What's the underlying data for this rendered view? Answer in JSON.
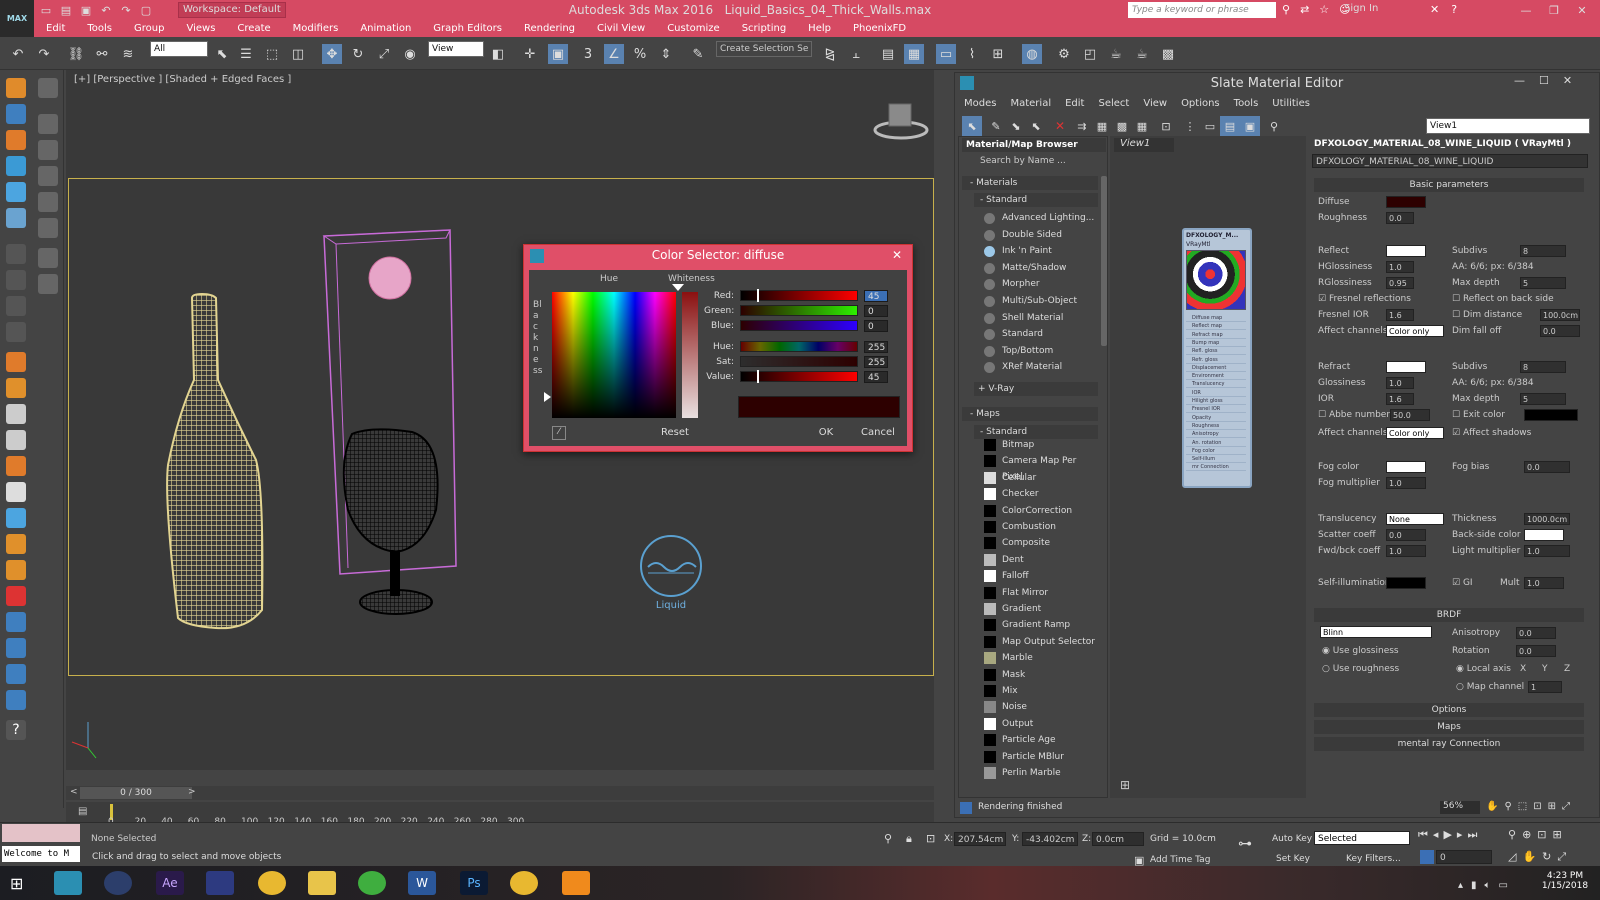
{
  "app": {
    "logo": "MAX",
    "workspace": "Workspace: Default",
    "title": "Autodesk 3ds Max 2016",
    "file": "Liquid_Basics_04_Thick_Walls.max",
    "search_placeholder": "Type a keyword or phrase",
    "signin": "Sign In"
  },
  "menu": [
    "Edit",
    "Tools",
    "Group",
    "Views",
    "Create",
    "Modifiers",
    "Animation",
    "Graph Editors",
    "Rendering",
    "Civil View",
    "Customize",
    "Scripting",
    "Help",
    "PhoenixFD"
  ],
  "toolbar": {
    "filter": "All",
    "refcoord": "View",
    "selset": "Create Selection Se",
    "snap_label": "3",
    "percent": "%"
  },
  "viewport": {
    "label": "[+] [Perspective ] [Shaded + Edged Faces ]",
    "helper": "Liquid"
  },
  "color_selector": {
    "title": "Color Selector: diffuse",
    "hue": "Hue",
    "whiteness": "Whiteness",
    "blackness": "Blackness",
    "channels": [
      {
        "label": "Red:",
        "value": "45"
      },
      {
        "label": "Green:",
        "value": "0"
      },
      {
        "label": "Blue:",
        "value": "0"
      },
      {
        "label": "Hue:",
        "value": "255"
      },
      {
        "label": "Sat:",
        "value": "255"
      },
      {
        "label": "Value:",
        "value": "45"
      }
    ],
    "reset": "Reset",
    "ok": "OK",
    "cancel": "Cancel",
    "swatch": "#2d0000"
  },
  "timeline": {
    "frame": "0 / 300",
    "ticks": [
      "0",
      "20",
      "40",
      "60",
      "80",
      "100",
      "120",
      "140",
      "160",
      "180",
      "200",
      "220",
      "240",
      "260",
      "280",
      "300"
    ]
  },
  "status": {
    "welcome": "Welcome to M",
    "selection": "None Selected",
    "prompt": "Click and drag to select and move objects",
    "x_label": "X:",
    "x": "207.54cm",
    "y_label": "Y:",
    "y": "-43.402cm",
    "z_label": "Z:",
    "z": "0.0cm",
    "grid": "Grid = 10.0cm",
    "autokey": "Auto Key",
    "autokey_mode": "Selected",
    "setkey": "Set Key",
    "keyfilters": "Key Filters...",
    "add_time_tag": "Add Time Tag",
    "frame_field": "0"
  },
  "taskbar": {
    "time": "4:23 PM",
    "date": "1/15/2018"
  },
  "slate": {
    "title": "Slate Material Editor",
    "menu": [
      "Modes",
      "Material",
      "Edit",
      "Select",
      "View",
      "Options",
      "Tools",
      "Utilities"
    ],
    "view_select": "View1",
    "browser_title": "Material/Map Browser",
    "search": "Search by Name ...",
    "view_tab": "View1",
    "status": "Rendering finished",
    "zoom": "56%",
    "materials_header": "Materials",
    "standard_header": "Standard",
    "vray_header": "+ V-Ray",
    "maps_header": "Maps",
    "maps_standard": "Standard",
    "materials": [
      "Advanced Lighting...",
      "Double Sided",
      "Ink 'n Paint",
      "Matte/Shadow",
      "Morpher",
      "Multi/Sub-Object",
      "Shell Material",
      "Standard",
      "Top/Bottom",
      "XRef Material"
    ],
    "maps": [
      "Bitmap",
      "Camera Map Per Pixel",
      "Cellular",
      "Checker",
      "ColorCorrection",
      "Combustion",
      "Composite",
      "Dent",
      "Falloff",
      "Flat Mirror",
      "Gradient",
      "Gradient Ramp",
      "Map Output Selector",
      "Marble",
      "Mask",
      "Mix",
      "Noise",
      "Output",
      "Particle Age",
      "Particle MBlur",
      "Perlin Marble"
    ],
    "node_title": "DFXOLOGY_M...",
    "node_sub": "VRayMtl",
    "node_slots": [
      "Diffuse map",
      "Reflect map",
      "Refract map",
      "Bump map",
      "Refl. gloss",
      "Refr. gloss",
      "Displacement",
      "Environment",
      "Translucency",
      "IOR",
      "Hilight gloss",
      "Fresnel IOR",
      "Opacity",
      "Roughness",
      "Anisotropy",
      "An. rotation",
      "Fog color",
      "Self-illum",
      "mr Connection"
    ]
  },
  "params": {
    "header": "DFXOLOGY_MATERIAL_08_WINE_LIQUID  ( VRayMtl )",
    "name": "DFXOLOGY_MATERIAL_08_WINE_LIQUID",
    "basic": "Basic parameters",
    "diffuse": "Diffuse",
    "roughness": "Roughness",
    "roughness_v": "0.0",
    "reflect": "Reflect",
    "hgloss": "HGlossiness",
    "hgloss_v": "1.0",
    "rgloss": "RGlossiness",
    "rgloss_v": "0.95",
    "fresnel": "Fresnel reflections",
    "fresnel_ior": "Fresnel IOR",
    "fresnel_ior_v": "1.6",
    "affect": "Affect channels",
    "affect_v": "Color only",
    "subdivs": "Subdivs",
    "subdivs_v": "8",
    "aa": "AA: 6/6; px: 6/384",
    "maxdepth": "Max depth",
    "maxdepth_v": "5",
    "backside": "Reflect on back side",
    "dimdist": "Dim distance",
    "dimdist_v": "100.0cm",
    "dimfall": "Dim fall off",
    "dimfall_v": "0.0",
    "refract": "Refract",
    "glossiness": "Glossiness",
    "gloss_v": "1.0",
    "ior": "IOR",
    "ior_v": "1.6",
    "abbe": "Abbe number",
    "abbe_v": "50.0",
    "affect2_v": "Color only",
    "subdivs2_v": "8",
    "maxdepth2_v": "5",
    "exitcolor": "Exit color",
    "affectshadows": "Affect shadows",
    "fogcolor": "Fog color",
    "fogmult": "Fog multiplier",
    "fogmult_v": "1.0",
    "fogbias": "Fog bias",
    "fogbias_v": "0.0",
    "transl": "Translucency",
    "transl_v": "None",
    "thickness": "Thickness",
    "thickness_v": "1000.0cm",
    "scatter": "Scatter coeff",
    "scatter_v": "0.0",
    "backside_color": "Back-side color",
    "fwdbck": "Fwd/bck coeff",
    "fwdbck_v": "1.0",
    "lightmult": "Light multiplier",
    "lightmult_v": "1.0",
    "selfillum": "Self-illumination",
    "gi": "GI",
    "mult": "Mult",
    "mult_v": "1.0",
    "brdf": "BRDF",
    "brdf_v": "Blinn",
    "aniso": "Anisotropy",
    "aniso_v": "0.0",
    "rotation": "Rotation",
    "rotation_v": "0.0",
    "useg": "Use glossiness",
    "user": "Use roughness",
    "localaxis": "Local axis",
    "ax": "X",
    "ay": "Y",
    "az": "Z",
    "mapch": "Map channel",
    "mapch_v": "1",
    "options": "Options",
    "maps": "Maps",
    "mentalray": "mental ray Connection"
  }
}
